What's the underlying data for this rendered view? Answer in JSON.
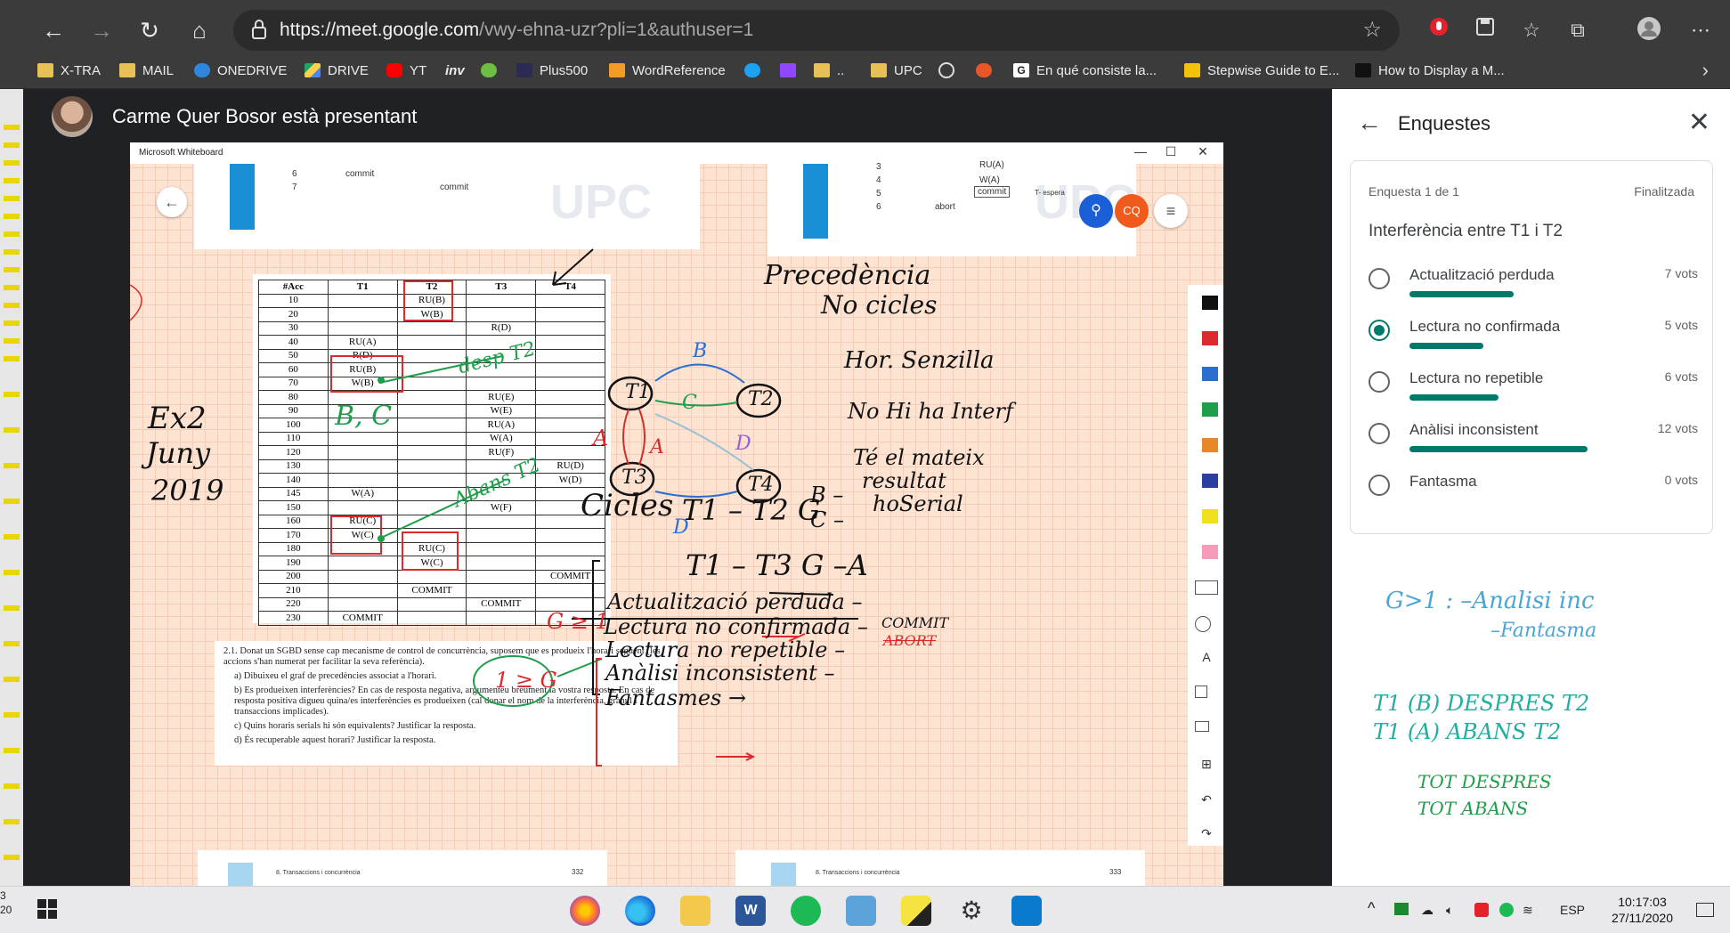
{
  "browser": {
    "url_host": "https://meet.google.com",
    "url_path": "/vwy-ehna-uzr?pli=1&authuser=1",
    "bookmarks": [
      "X-TRA",
      "MAIL",
      "ONEDRIVE",
      "DRIVE",
      "YT",
      "inv",
      "Plus500",
      "WordReference",
      "UPC",
      "En qué consiste la...",
      "Stepwise Guide to E...",
      "How to Display a M..."
    ]
  },
  "meet": {
    "presenter_label": "Carme Quer Bosor està presentant"
  },
  "whiteboard": {
    "window_title": "Microsoft Whiteboard",
    "avatar_initials": "CQ",
    "top_left_page": {
      "rows": [
        [
          "6",
          "commit",
          ""
        ],
        [
          "7",
          "",
          "commit"
        ]
      ]
    },
    "top_right_page": {
      "rows": [
        [
          "3",
          "",
          "RU(A)"
        ],
        [
          "4",
          "",
          "W(A)"
        ],
        [
          "5",
          "",
          "commit"
        ],
        [
          "6",
          "abort",
          ""
        ]
      ],
      "note": "T- espera"
    },
    "schedule": {
      "headers": [
        "#Acc",
        "T1",
        "T2",
        "T3",
        "T4"
      ],
      "rows": [
        [
          "10",
          "",
          "RU(B)",
          "",
          ""
        ],
        [
          "20",
          "",
          "W(B)",
          "",
          ""
        ],
        [
          "30",
          "",
          "",
          "R(D)",
          ""
        ],
        [
          "40",
          "RU(A)",
          "",
          "",
          ""
        ],
        [
          "50",
          "R(D)",
          "",
          "",
          ""
        ],
        [
          "60",
          "RU(B)",
          "",
          "",
          ""
        ],
        [
          "70",
          "W(B)",
          "",
          "",
          ""
        ],
        [
          "80",
          "",
          "",
          "RU(E)",
          ""
        ],
        [
          "90",
          "",
          "",
          "W(E)",
          ""
        ],
        [
          "100",
          "",
          "",
          "RU(A)",
          ""
        ],
        [
          "110",
          "",
          "",
          "W(A)",
          ""
        ],
        [
          "120",
          "",
          "",
          "RU(F)",
          ""
        ],
        [
          "130",
          "",
          "",
          "",
          "RU(D)"
        ],
        [
          "140",
          "",
          "",
          "",
          "W(D)"
        ],
        [
          "145",
          "W(A)",
          "",
          "",
          ""
        ],
        [
          "150",
          "",
          "",
          "W(F)",
          ""
        ],
        [
          "160",
          "RU(C)",
          "",
          "",
          ""
        ],
        [
          "170",
          "W(C)",
          "",
          "",
          ""
        ],
        [
          "180",
          "",
          "RU(C)",
          "",
          ""
        ],
        [
          "190",
          "",
          "W(C)",
          "",
          ""
        ],
        [
          "200",
          "",
          "",
          "",
          "COMMIT"
        ],
        [
          "210",
          "",
          "COMMIT",
          "",
          ""
        ],
        [
          "220",
          "",
          "",
          "COMMIT",
          ""
        ],
        [
          "230",
          "COMMIT",
          "",
          "",
          ""
        ]
      ]
    },
    "exercise": {
      "intro": "2.1. Donat un SGBD sense cap mecanisme de control de concurrència, suposem que es produeix l'horari següent (les accions s'han numerat per facilitar la seva referència).",
      "a": "a) Dibuixeu el graf de precedències associat a l'horari.",
      "b": "b) Es produeixen interferències? En cas de resposta negativa, argumenteu breument la vostra resposta. En cas de resposta positiva digueu quina/es interferències es produeixen (cal donar el nom de la interferència, grànul i transaccions implicades).",
      "c": "c) Quins horaris serials hi són equivalents? Justificar la resposta.",
      "d": "d) És recuperable aquest horari? Justificar la resposta."
    },
    "handwriting": {
      "ex_label": [
        "Ex2",
        "Juny",
        "2019"
      ],
      "desp": "desp T2",
      "bc": "B, C",
      "abans": "Abans T2",
      "precedencia": "Precedència",
      "no_cicles": "No cicles",
      "hor_senzill": "Hor. Senzilla",
      "no_interf": "No Hi ha Interf",
      "mateix": [
        "Té el mateix",
        "resultat",
        "hoSerial"
      ],
      "cicles": "Cicles",
      "c1": "T1 – T2 G",
      "c1_b": "B –",
      "c1_c": "C –",
      "c2": "T1 – T3 G –A",
      "interf": [
        "Actualització perduda –",
        "Lectura no confirmada –",
        "Lectura no repetible –",
        "Anàlisi inconsistent –",
        "Fantasmes →"
      ],
      "commit": "COMMIT",
      "abort": "ABORT",
      "g_gt1": "G ≥ 1",
      "g1": "1 ≥ G",
      "nodes": [
        "T1",
        "T2",
        "T3",
        "T4"
      ],
      "edge_labels": [
        "B",
        "C",
        "A",
        "A",
        "D",
        "D"
      ],
      "footer_left": "8. Transaccions i concurrència",
      "footer_left_page": "332",
      "footer_right": "8. Transaccions i concurrència",
      "footer_right_page": "333"
    }
  },
  "panel": {
    "title": "Enquestes",
    "counter": "Enquesta 1 de 1",
    "status": "Finalitzada",
    "question": "Interferència entre T1 i T2",
    "options": [
      {
        "label": "Actualització perduda",
        "votes": "7 vots",
        "count": 7,
        "selected": false
      },
      {
        "label": "Lectura no confirmada",
        "votes": "5 vots",
        "count": 5,
        "selected": true
      },
      {
        "label": "Lectura no repetible",
        "votes": "6 vots",
        "count": 6,
        "selected": false
      },
      {
        "label": "Anàlisi inconsistent",
        "votes": "12 vots",
        "count": 12,
        "selected": false
      },
      {
        "label": "Fantasma",
        "votes": "0 vots",
        "count": 0,
        "selected": false
      }
    ],
    "notes": [
      "G>1 : –Analisi inc",
      "–Fantasma",
      "T1 (B) DESPRES T2",
      "T1 (A) ABANS T2",
      "TOT DESPRES",
      "TOT ABANS"
    ]
  },
  "taskbar": {
    "lang": "ESP",
    "time": "10:17:03",
    "date": "27/11/2020",
    "left_edge": [
      "3",
      "20"
    ]
  }
}
